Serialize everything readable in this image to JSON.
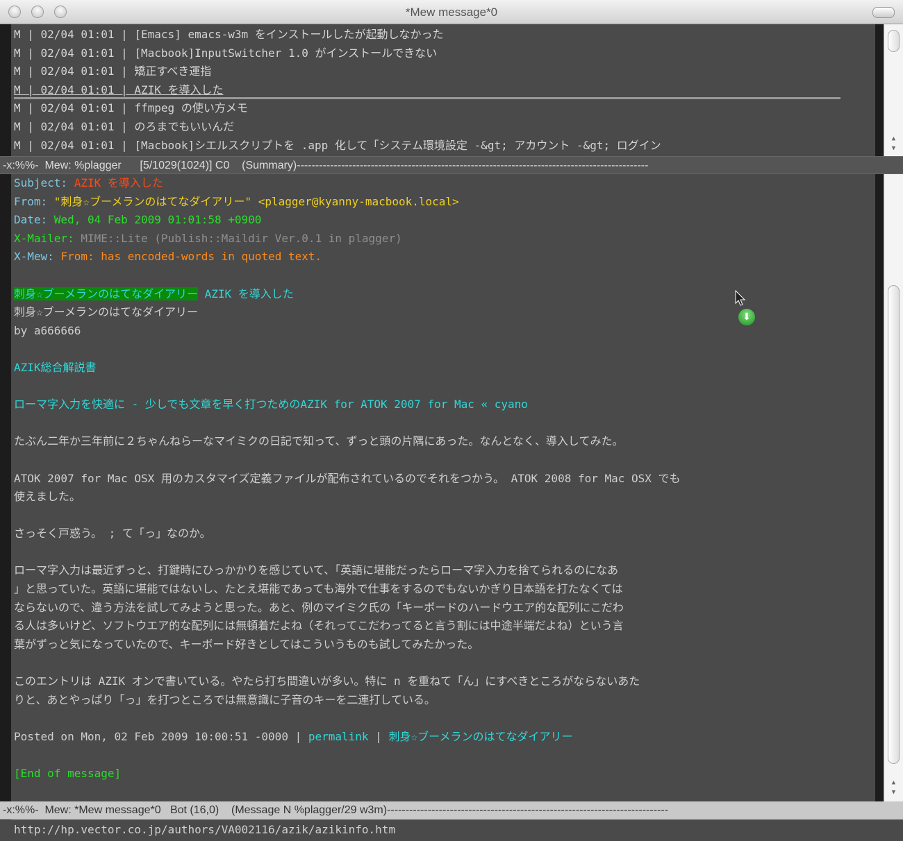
{
  "window": {
    "title": "*Mew message*0"
  },
  "summary": {
    "rows": [
      "M | 02/04 01:01 | [Emacs] emacs-w3m をインストールしたが起動しなかった",
      "M | 02/04 01:01 | [Macbook]InputSwitcher 1.0 がインストールできない",
      "M | 02/04 01:01 | 矯正すべき運指",
      "M | 02/04 01:01 | AZIK を導入した",
      "M | 02/04 01:01 | ffmpeg の使い方メモ",
      "M | 02/04 01:01 | のろまでもいいんだ",
      "M | 02/04 01:01 | [Macbook]シエルスクリプトを .app 化して「システム環境設定 -&gt; アカウント -&gt; ログイン"
    ],
    "current_index": 3,
    "modeline": "-x:%%-  Mew: %plagger      [5/1029(1024)] C0    (Summary)-----------------------------------------------------------------------------------------------"
  },
  "message": {
    "lines": [
      [
        {
          "t": "Subject: ",
          "c": "hk"
        },
        {
          "t": "AZIK を導入した",
          "c": "subj"
        }
      ],
      [
        {
          "t": "From: ",
          "c": "hk"
        },
        {
          "t": "\"刺身☆ブーメランのはてなダイアリー\" <plagger@kyanny-macbook.local>",
          "c": "from"
        }
      ],
      [
        {
          "t": "Date: ",
          "c": "hk"
        },
        {
          "t": "Wed, 04 Feb 2009 01:01:58 +0900",
          "c": "date"
        }
      ],
      [
        {
          "t": "X-Mailer: ",
          "c": "xm-k"
        },
        {
          "t": "MIME::Lite (Publish::Maildir Ver.0.1 in plagger)",
          "c": "xm-v"
        }
      ],
      [
        {
          "t": "X-Mew: ",
          "c": "hk"
        },
        {
          "t": "From: has encoded-words in quoted text.",
          "c": "xmew-v"
        }
      ],
      [],
      [
        {
          "t": "刺身☆ブーメランのはてなダイアリー",
          "c": "greybg"
        },
        {
          "t": " AZIK を導入した",
          "c": "cyan"
        }
      ],
      [
        {
          "t": "刺身☆ブーメランのはてなダイアリー",
          "c": "txt"
        }
      ],
      [
        {
          "t": "by a666666",
          "c": "txt"
        }
      ],
      [],
      [
        {
          "t": "AZIK総合解説書",
          "c": "cyan"
        }
      ],
      [],
      [
        {
          "t": "ローマ字入力を快適に - 少しでも文章を早く打つためのAZIK for ATOK 2007 for Mac « cyano",
          "c": "cyan"
        }
      ],
      [],
      [
        {
          "t": "たぶん二年か三年前に２ちゃんねらーなマイミクの日記で知って、ずっと頭の片隅にあった。なんとなく、導入してみた。",
          "c": "txt"
        }
      ],
      [],
      [
        {
          "t": "ATOK 2007 for Mac OSX 用のカスタマイズ定義ファイルが配布されているのでそれをつかう。 ATOK 2008 for Mac OSX でも",
          "c": "txt"
        }
      ],
      [
        {
          "t": "使えました。",
          "c": "txt"
        }
      ],
      [],
      [
        {
          "t": "さっそく戸惑う。 ; て「っ」なのか。",
          "c": "txt"
        }
      ],
      [],
      [
        {
          "t": "ローマ字入力は最近ずっと、打鍵時にひっかかりを感じていて、「英語に堪能だったらローマ字入力を捨てられるのになあ",
          "c": "txt"
        }
      ],
      [
        {
          "t": "」と思っていた。英語に堪能ではないし、たとえ堪能であっても海外で仕事をするのでもないかぎり日本語を打たなくては",
          "c": "txt"
        }
      ],
      [
        {
          "t": "ならないので、違う方法を試してみようと思った。あと、例のマイミク氏の「キーボードのハードウエア的な配列にこだわ",
          "c": "txt"
        }
      ],
      [
        {
          "t": "る人は多いけど、ソフトウエア的な配列には無頓着だよね（それってこだわってると言う割には中途半端だよね）という言",
          "c": "txt"
        }
      ],
      [
        {
          "t": "葉がずっと気になっていたので、キーボード好きとしてはこういうものも試してみたかった。",
          "c": "txt"
        }
      ],
      [],
      [
        {
          "t": "このエントリは AZIK オンで書いている。やたら打ち間違いが多い。特に n を重ねて「ん」にすべきところがならないあた",
          "c": "txt"
        }
      ],
      [
        {
          "t": "りと、あとやっぱり「っ」を打つところでは無意識に子音のキーを二連打している。",
          "c": "txt"
        }
      ],
      [],
      [
        {
          "t": "Posted on Mon, 02 Feb 2009 10:00:51 -0000 | ",
          "c": "txt"
        },
        {
          "t": "permalink",
          "c": "cyan"
        },
        {
          "t": " | ",
          "c": "txt"
        },
        {
          "t": "刺身☆ブーメランのはてなダイアリー",
          "c": "cyan"
        }
      ],
      [],
      [
        {
          "t": "[End of message]",
          "c": "endm"
        }
      ]
    ],
    "modeline": "-x:%%-  Mew: *Mew message*0   Bot (16,0)    (Message N %plagger/29 w3m)----------------------------------------------------------------------------"
  },
  "minibuffer": {
    "text": "http://hp.vector.co.jp/authors/VA002116/azik/azikinfo.htm"
  }
}
